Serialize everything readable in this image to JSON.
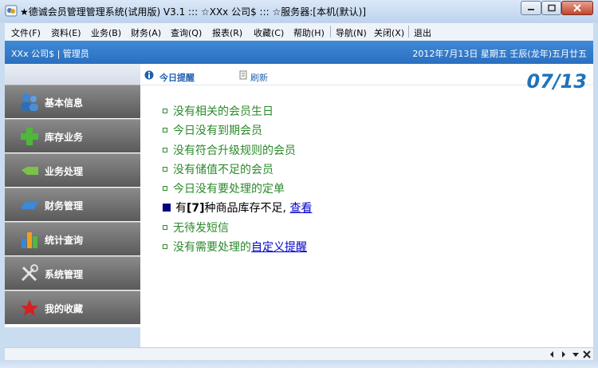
{
  "window": {
    "title": "★德诚会员管理管理系统(试用版) V3.1  ::: ☆XXx 公司$ ::: ☆服务器:[本机(默认)]",
    "controls": [
      "minimize",
      "maximize",
      "close"
    ]
  },
  "menu": {
    "items": [
      "文件(F)",
      "资料(E)",
      "业务(B)",
      "财务(A)",
      "查询(Q)",
      "报表(R)",
      "收藏(C)",
      "帮助(H)",
      "导航(N)",
      "关闭(X)",
      "退出"
    ]
  },
  "header": {
    "company": "XXx 公司$ | 管理员",
    "date": "2012年7月13日   星期五   壬辰(龙年)五月廿五"
  },
  "sidebar": {
    "items": [
      {
        "label": "基本信息",
        "icon": "users-icon"
      },
      {
        "label": "库存业务",
        "icon": "plus-icon"
      },
      {
        "label": "业务处理",
        "icon": "tag-icon"
      },
      {
        "label": "财务管理",
        "icon": "card-icon"
      },
      {
        "label": "统计查询",
        "icon": "bar-chart-icon"
      },
      {
        "label": "系统管理",
        "icon": "tools-icon"
      },
      {
        "label": "我的收藏",
        "icon": "star-icon"
      }
    ]
  },
  "tabs": {
    "today": "今日提醒",
    "refresh": "刷新",
    "date_badge": "07/13"
  },
  "notices": {
    "n1": "没有相关的会员生日",
    "n2": "今日没有到期会员",
    "n3": "没有符合升级规则的会员",
    "n4": "没有储值不足的会员",
    "n5": "今日没有要处理的定单",
    "n6_prefix": "有",
    "n6_count": "[7]",
    "n6_text": "种商品库存不足,",
    "n6_link": "查看",
    "n7": "无待发短信",
    "n8_prefix": "没有需要处理的",
    "n8_link": "自定义提醒"
  },
  "colors": {
    "header_blue": "#2a6fc0",
    "notice_green": "#2a8a2a",
    "link_blue": "#0000cc",
    "date_badge": "#2273b8"
  }
}
